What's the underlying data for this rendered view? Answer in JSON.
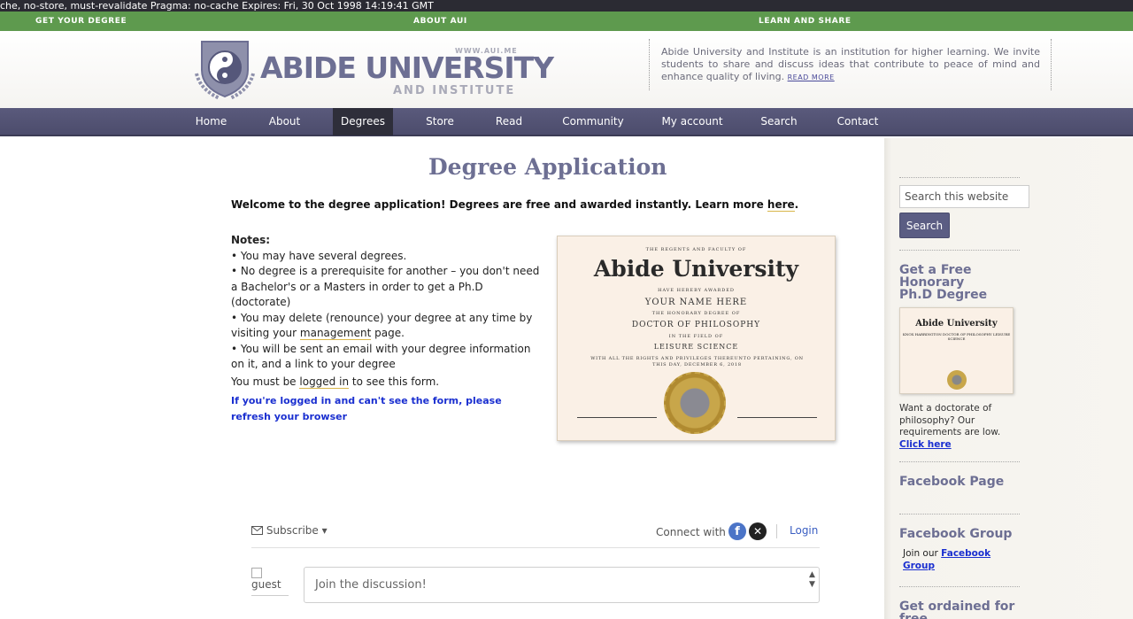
{
  "header_strip": "che, no-store, must-revalidate Pragma: no-cache Expires: Fri, 30 Oct 1998 14:19:41 GMT",
  "topbar": {
    "left": "GET YOUR DEGREE",
    "center": "ABOUT AUI",
    "right": "LEARN AND SHARE"
  },
  "logo": {
    "url": "WWW.AUI.ME",
    "name": "ABIDE UNIVERSITY",
    "sub": "AND INSTITUTE"
  },
  "tagline": {
    "text": "Abide University and Institute is an institution for higher learning. We invite students to share and discuss ideas that contribute to peace of mind and enhance quality of living.",
    "link": "READ MORE"
  },
  "nav": [
    "Home",
    "About",
    "Degrees",
    "Store",
    "Read",
    "Community",
    "My account",
    "Search",
    "Contact"
  ],
  "main": {
    "title": "Degree Application",
    "welcome_pre": "Welcome to the degree application! Degrees are free and awarded instantly. Learn more ",
    "welcome_link": "here",
    "welcome_post": ".",
    "notes_heading": "Notes:",
    "note1": "• You may have several degrees.",
    "note2": "• No degree is a prerequisite for another – you don't need a Bachelor's or a Masters in order to get a Ph.D (doctorate)",
    "note3_pre": "• You may delete (renounce) your degree at any time by visiting your ",
    "note3_link": "management",
    "note3_post": " page.",
    "note4": "• You will be sent an email with your degree information on it, and a link to your degree",
    "logged_pre": "You must be ",
    "logged_link": "logged in",
    "logged_post": " to see this form.",
    "refresh": "If you're logged in and can't see the form, please refresh your browser"
  },
  "certificate": {
    "line1": "THE REGENTS AND FACULTY OF",
    "name": "Abide University",
    "line3": "HAVE HEREBY AWARDED",
    "recipient": "YOUR NAME HERE",
    "line5": "THE HONORARY DEGREE OF",
    "degree": "DOCTOR OF PHILOSOPHY",
    "line7": "IN THE FIELD OF",
    "field": "LEISURE SCIENCE",
    "line9": "WITH ALL THE RIGHTS AND PRIVILEGES THEREUNTO PERTAINING, ON THIS DAY, DECEMBER 6, 2018"
  },
  "comments": {
    "subscribe": "Subscribe",
    "connect": "Connect with",
    "login": "Login",
    "guest": "guest",
    "placeholder": "Join the discussion!"
  },
  "sidebar": {
    "search_placeholder": "Search this website",
    "search_button": "Search",
    "honorary_heading": "Get a Free Honorary Ph.D Degree",
    "thumb_title": "Abide University",
    "thumb_sub": "KNOX HARRINGTON DOCTOR OF PHILOSOPHY LEISURE SCIENCE",
    "honorary_text": "Want a doctorate of philosophy? Our requirements are low.",
    "click_here": "Click here",
    "facebook_page": "Facebook Page",
    "facebook_group": "Facebook Group",
    "join_pre": "Join our ",
    "join_link": "Facebook Group",
    "ordained": "Get ordained for free"
  }
}
